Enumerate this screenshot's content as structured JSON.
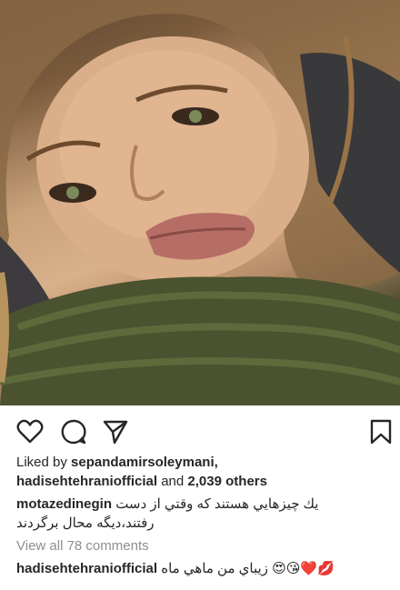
{
  "post": {
    "image_alt": "selfie photo",
    "liked_by_prefix": "Liked by",
    "liked_by_user": "sepandamirsoleymani,",
    "liked_by_user2": "hadisehtehraniofficial",
    "liked_and": "and",
    "likes_count": "2,039",
    "likes_suffix": "others",
    "comment1_user": "motazedinegin",
    "comment1_text_line1": "يك چيزهايي هستند كه وقتي از دست",
    "comment1_text_line2": "رفتند،ديگه محال برگردند",
    "view_all_comments": "View all 78 comments",
    "comment2_user": "hadisehtehraniofficial",
    "comment2_text": "زيباي من ماهي ماه",
    "comment2_emojis": "😍😘❤️💋"
  },
  "icons": {
    "like": "heart-icon",
    "comment": "comment-bubble-icon",
    "share": "paper-plane-icon",
    "save": "bookmark-icon"
  },
  "colors": {
    "text": "#262626",
    "muted": "#8e8e8e",
    "background": "#ffffff"
  }
}
